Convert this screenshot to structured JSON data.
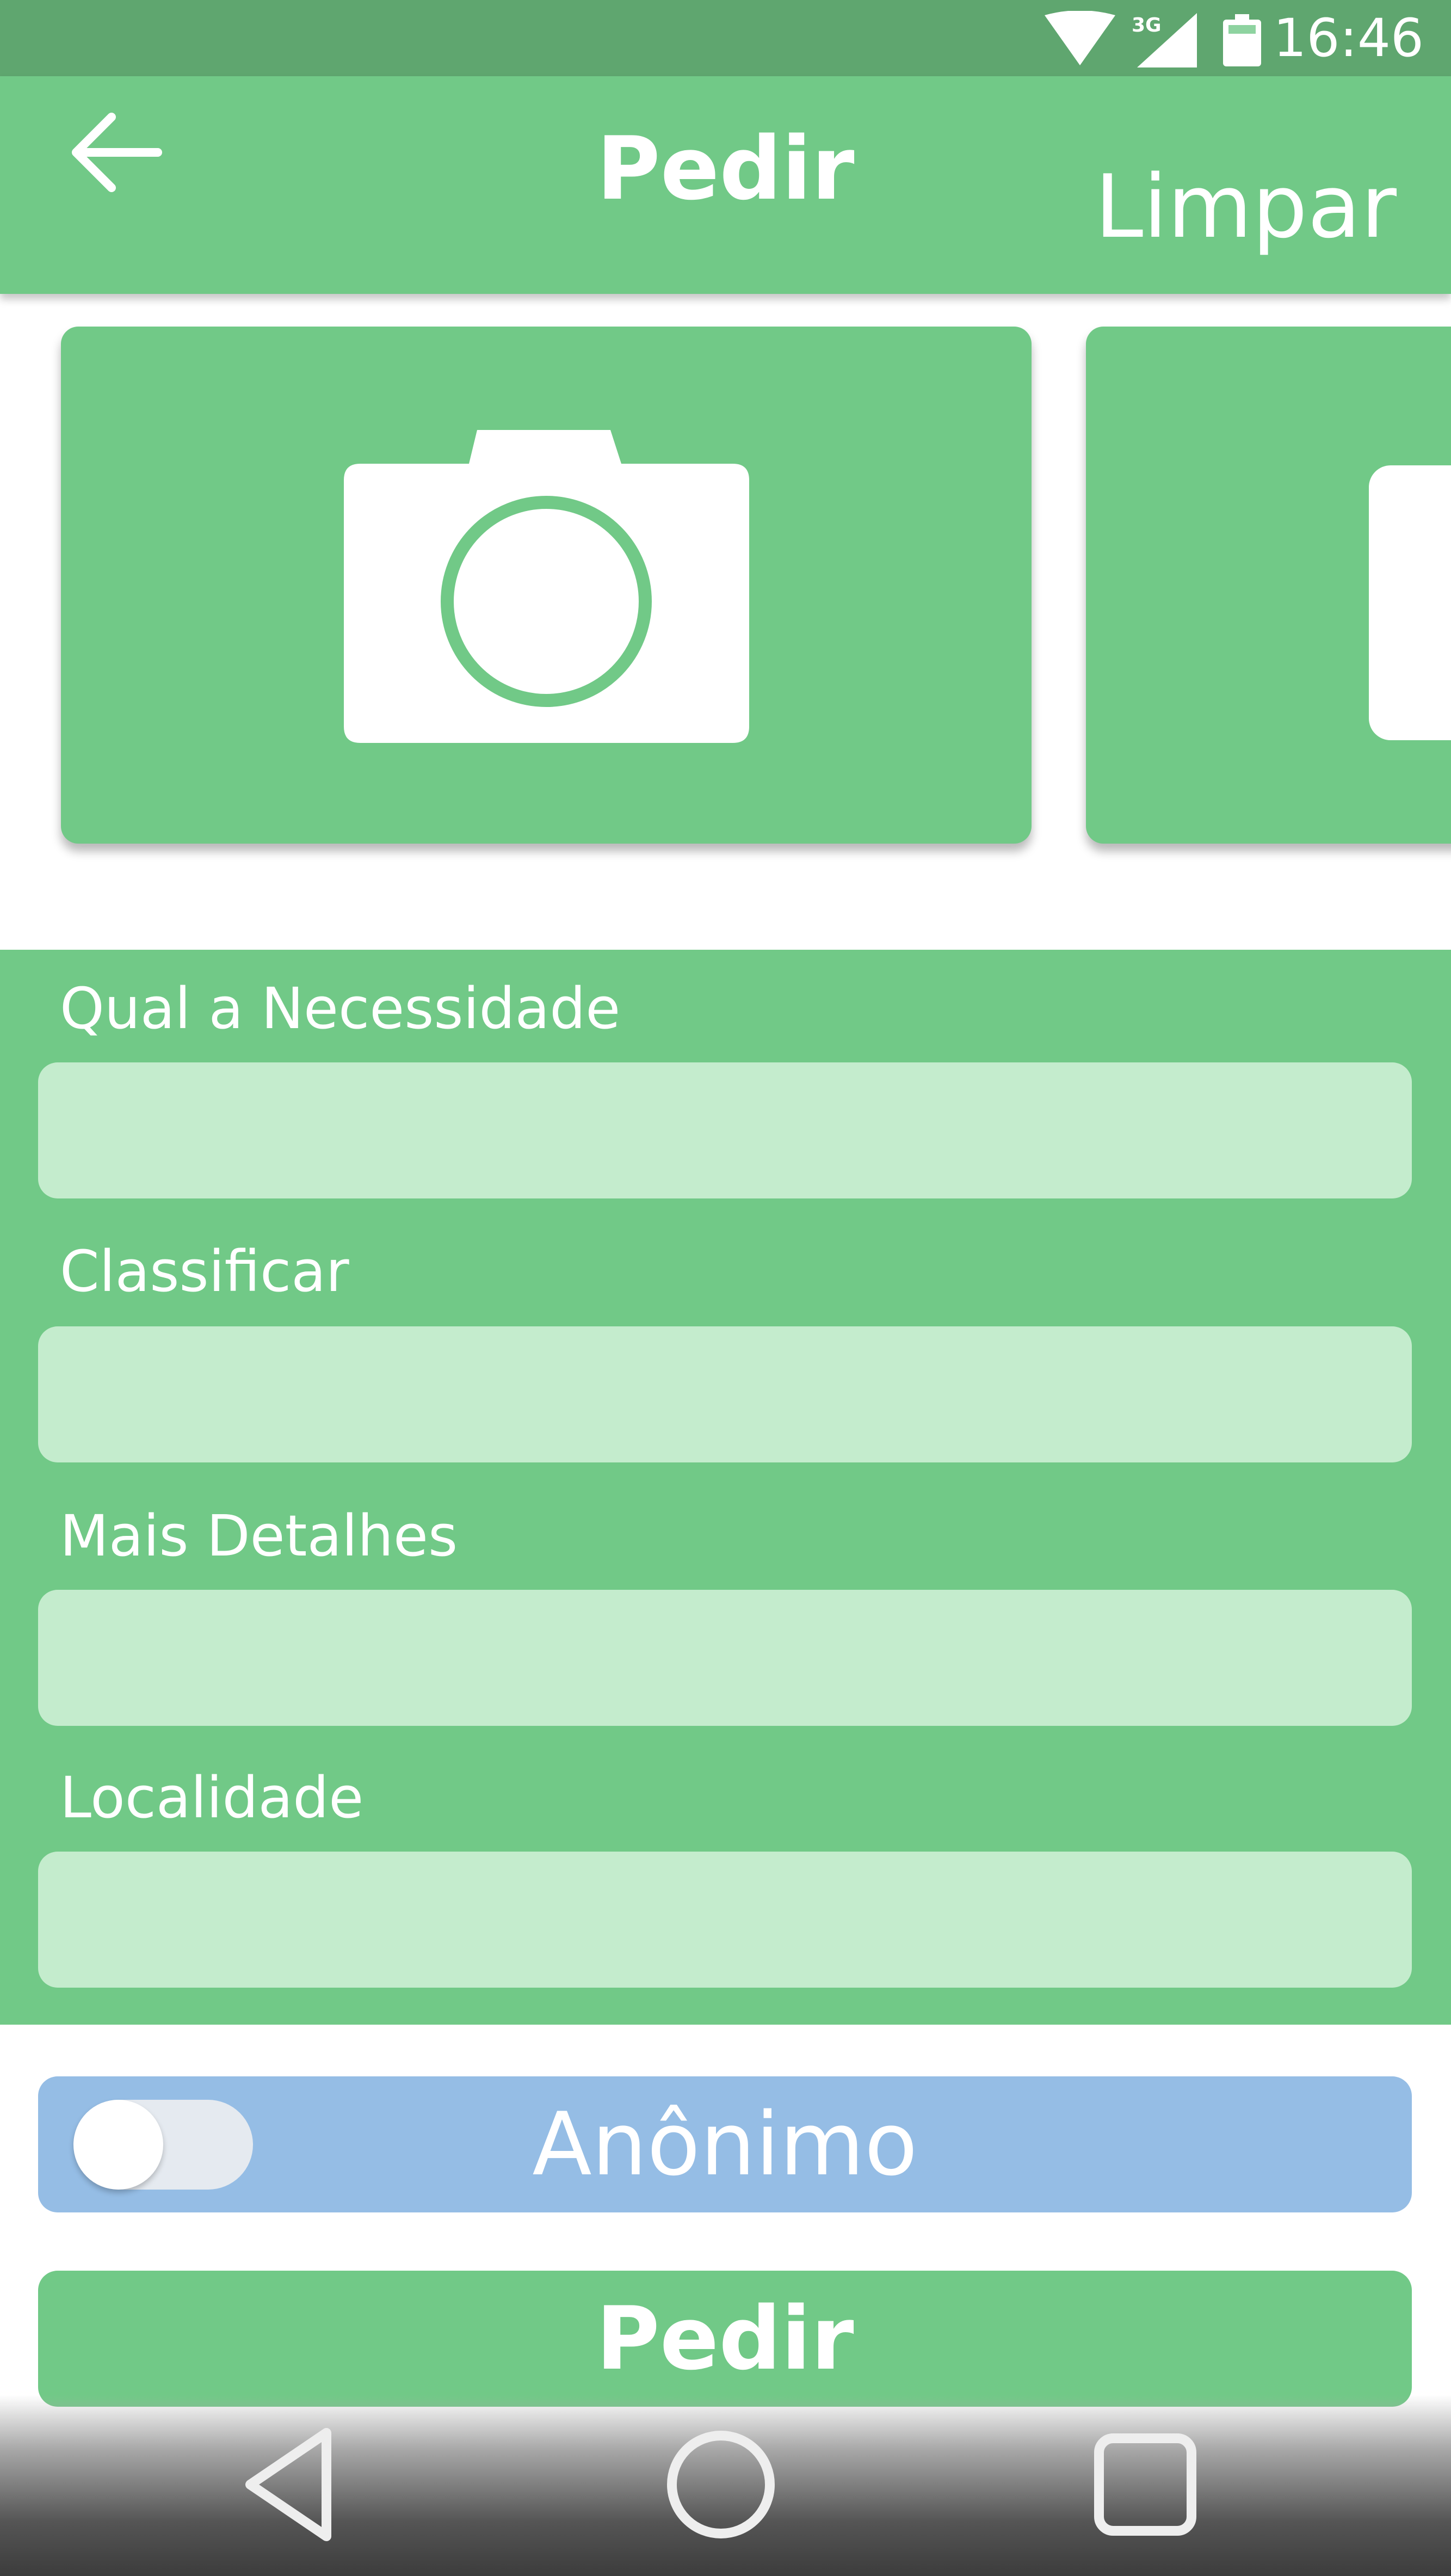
{
  "status_bar": {
    "time": "16:46",
    "network_type": "3G",
    "icons": [
      "wifi-icon",
      "signal-icon",
      "battery-icon"
    ]
  },
  "app_bar": {
    "title": "Pedir",
    "back_icon": "arrow-left-icon",
    "clear_label": "Limpar"
  },
  "photos": {
    "cards": [
      {
        "icon": "camera-icon"
      },
      {
        "icon": "camera-icon"
      }
    ]
  },
  "form": {
    "fields": [
      {
        "label": "Qual a Necessidade",
        "value": "",
        "placeholder": ""
      },
      {
        "label": "Classificar",
        "value": "",
        "placeholder": ""
      },
      {
        "label": "Mais Detalhes",
        "value": "",
        "placeholder": ""
      },
      {
        "label": "Localidade",
        "value": "",
        "placeholder": ""
      }
    ]
  },
  "anonymous": {
    "label": "Anônimo",
    "enabled": false
  },
  "submit": {
    "label": "Pedir"
  },
  "nav_bar": {
    "icons": [
      "back-triangle-icon",
      "home-circle-icon",
      "recents-square-icon"
    ]
  },
  "colors": {
    "primary_green": "#71c987",
    "status_green": "#5fa66f",
    "input_green": "#c4eccd",
    "toggle_blue": "#95bde5",
    "white": "#ffffff"
  }
}
